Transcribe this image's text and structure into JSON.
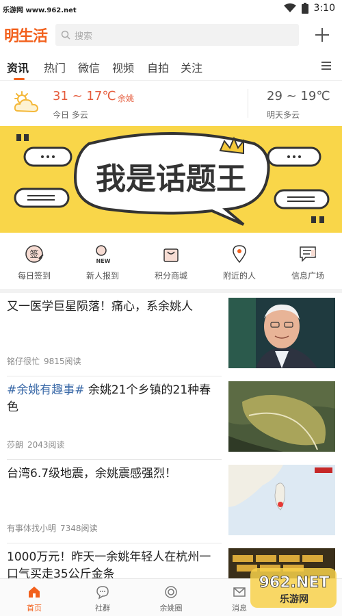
{
  "status_bar": {
    "watermark": "乐游网 www.962.net",
    "time": "3:10"
  },
  "header": {
    "logo": "明生活",
    "search_placeholder": "搜索"
  },
  "tabs": [
    {
      "label": "资讯",
      "active": true
    },
    {
      "label": "热门"
    },
    {
      "label": "微信"
    },
    {
      "label": "视频"
    },
    {
      "label": "自拍"
    },
    {
      "label": "关注"
    }
  ],
  "weather": {
    "today_temp": "31 ~ 17℃",
    "city": "余姚",
    "today_desc": "今日 多云",
    "tomorrow_temp": "29 ~ 19℃",
    "tomorrow_desc": "明天多云"
  },
  "banner": {
    "text": "我是话题王",
    "bg_color": "#f9d649"
  },
  "shortcuts": [
    {
      "label": "每日签到",
      "icon": "sign-in-icon"
    },
    {
      "label": "新人报到",
      "icon": "new-user-icon"
    },
    {
      "label": "积分商城",
      "icon": "shopping-bag-icon"
    },
    {
      "label": "附近的人",
      "icon": "location-pin-icon"
    },
    {
      "label": "信息广场",
      "icon": "message-board-icon"
    }
  ],
  "news": [
    {
      "title": "又一医学巨星陨落！痛心，系余姚人",
      "hashtag": "",
      "author": "铭仔很忙",
      "reads": "9815阅读"
    },
    {
      "title": "余姚21个乡镇的21种春色",
      "hashtag": "#余姚有趣事#",
      "author": "莎朗",
      "reads": "2043阅读"
    },
    {
      "title": "台湾6.7级地震，余姚震感强烈！",
      "hashtag": "",
      "author": "有事体找小明",
      "reads": "7348阅读"
    },
    {
      "title": "1000万元！昨天一余姚年轻人在杭州一口气买走35公斤金条",
      "hashtag": "",
      "author": "",
      "reads": ""
    }
  ],
  "bottom_nav": [
    {
      "label": "首页",
      "active": true
    },
    {
      "label": "社群"
    },
    {
      "label": "余姚圈"
    },
    {
      "label": "消息"
    }
  ],
  "watermark_bottom": {
    "brand": "962.NET",
    "sub": "乐游网"
  },
  "colors": {
    "accent": "#f2601c",
    "weather_red": "#e55b3b",
    "hashtag_blue": "#3b6aa8"
  }
}
